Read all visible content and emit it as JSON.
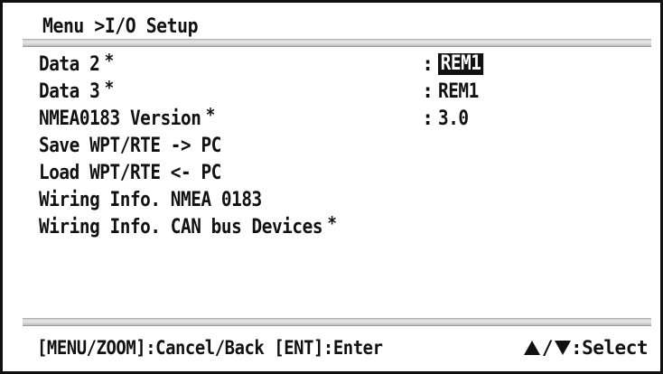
{
  "header": {
    "breadcrumb": "Menu >I/O Setup"
  },
  "items": [
    {
      "label": "Data 2",
      "star": "*",
      "colon": ":",
      "value": "REM1",
      "selected": true
    },
    {
      "label": "Data 3",
      "star": "*",
      "colon": ":",
      "value": "REM1"
    },
    {
      "label": "NMEA0183 Version",
      "star": "*",
      "colon": ":",
      "value": "3.0"
    },
    {
      "label": "Save WPT/RTE -> PC"
    },
    {
      "label": "Load WPT/RTE <- PC"
    },
    {
      "label": "Wiring Info. NMEA 0183"
    },
    {
      "label": "Wiring Info. CAN bus Devices",
      "star": "*"
    }
  ],
  "footer": {
    "left_text": "[MENU/ZOOM]:Cancel/Back [ENT]:Enter",
    "slash": "/",
    "select_text": ":Select",
    "up_icon": "triangle-up-icon",
    "down_icon": "triangle-down-icon"
  }
}
